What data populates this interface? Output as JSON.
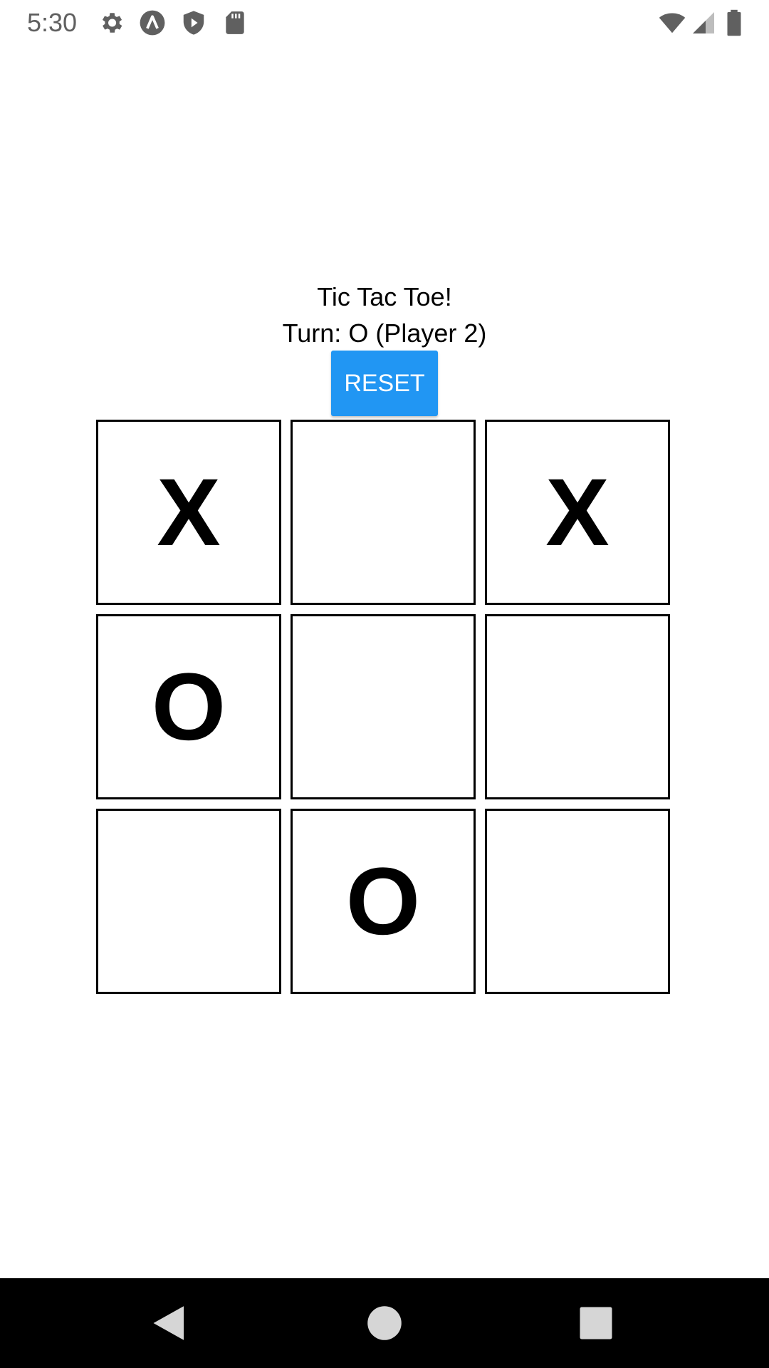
{
  "status_bar": {
    "time": "5:30",
    "left_icons": [
      "settings-icon",
      "app-a-icon",
      "play-protect-icon",
      "sd-card-icon"
    ],
    "right_icons": [
      "wifi-icon",
      "cell-signal-icon",
      "battery-icon"
    ]
  },
  "game": {
    "title": "Tic Tac Toe!",
    "turn_text": "Turn: O (Player 2)",
    "reset_label": "RESET",
    "reset_color": "#2196F3",
    "board": [
      "X",
      "",
      "X",
      "O",
      "",
      "",
      "",
      "O",
      ""
    ]
  },
  "nav_bar": {
    "buttons": [
      "back-icon",
      "home-icon",
      "recents-icon"
    ]
  }
}
